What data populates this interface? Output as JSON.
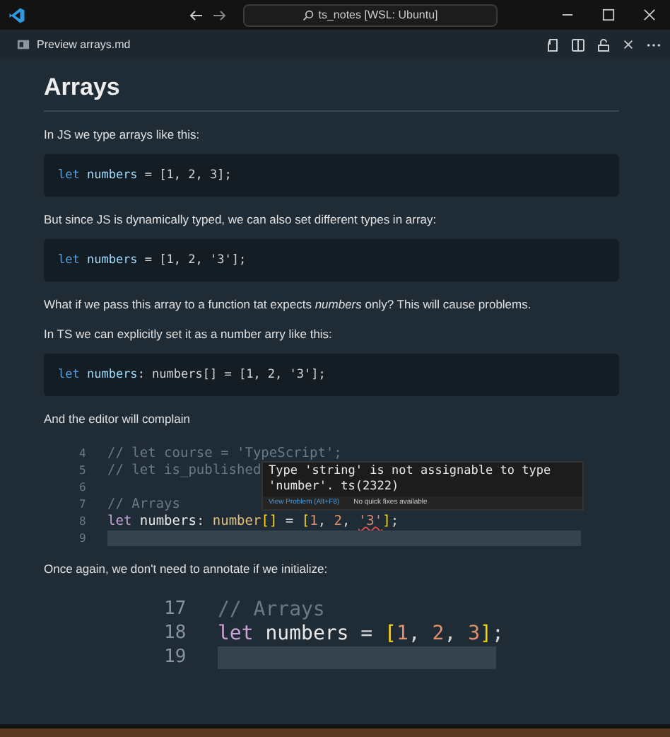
{
  "titlebar": {
    "search": "ts_notes [WSL: Ubuntu]"
  },
  "tab": {
    "title": "Preview arrays.md"
  },
  "content": [
    {
      "kind": "heading",
      "text": "Arrays"
    },
    {
      "kind": "paragraph",
      "text": "In JS we type arrays like this:"
    },
    {
      "kind": "code",
      "tokens": [
        {
          "kind": "keyword",
          "t": "let"
        },
        {
          "kind": "variable",
          "t": " numbers"
        },
        {
          "kind": "plain",
          "t": " = [1, 2, 3];"
        }
      ]
    },
    {
      "kind": "paragraph",
      "text": "But since JS is dynamically typed, we can also set different types in array:"
    },
    {
      "kind": "code",
      "tokens": [
        {
          "kind": "keyword",
          "t": "let"
        },
        {
          "kind": "variable",
          "t": " numbers"
        },
        {
          "kind": "plain",
          "t": " = [1, 2, '3'];"
        }
      ]
    },
    {
      "kind": "paragraph",
      "text": "What if we pass this array to a function tat expects *numbers* only? This will cause problems."
    },
    {
      "kind": "paragraph",
      "text": "In TS we can explicitly set it as a number arry like this:"
    },
    {
      "kind": "code",
      "tokens": [
        {
          "kind": "keyword",
          "t": "let"
        },
        {
          "kind": "variable",
          "t": " numbers"
        },
        {
          "kind": "plain",
          "t": ": numbers[] = [1, 2, '3'];"
        }
      ]
    },
    {
      "kind": "paragraph",
      "text": "And the editor will complain"
    },
    {
      "kind": "screenshot",
      "lines": [
        {
          "n": "4",
          "current": false,
          "tokens": [
            {
              "kind": "comment",
              "t": "// let course = 'TypeScript';"
            }
          ]
        },
        {
          "n": "5",
          "current": false,
          "tokens": [
            {
              "kind": "comment",
              "t": "// let is_published"
            }
          ]
        },
        {
          "n": "6",
          "current": false
        },
        {
          "n": "7",
          "current": false,
          "tokens": [
            {
              "kind": "comment",
              "t": "// Arrays"
            }
          ]
        },
        {
          "n": "8",
          "current": false,
          "tokens": [
            {
              "kind": "keyword",
              "t": "let"
            },
            {
              "kind": "variable",
              "t": " numbers"
            },
            {
              "kind": "plain",
              "t": ": "
            },
            {
              "kind": "type",
              "t": "number"
            },
            {
              "kind": "bracket",
              "t": "[]"
            },
            {
              "kind": "plain",
              "t": " = "
            },
            {
              "kind": "bracket",
              "t": "["
            },
            {
              "kind": "number",
              "t": "1"
            },
            {
              "kind": "plain",
              "t": ", "
            },
            {
              "kind": "number",
              "t": "2"
            },
            {
              "kind": "plain",
              "t": ", "
            },
            {
              "kind": "string",
              "t": "'3'",
              "error": true
            },
            {
              "kind": "bracket",
              "t": "]"
            },
            {
              "kind": "plain",
              "t": ";"
            }
          ]
        },
        {
          "n": "9",
          "current": true
        }
      ],
      "tooltip": {
        "message": "Type 'string' is not assignable to type 'number'. ts(2322)",
        "link": "View Problem (Alt+F8)",
        "note": "No quick fixes available"
      }
    },
    {
      "kind": "paragraph",
      "text": "Once again, we don't need to annotate if we initialize:"
    },
    {
      "kind": "zoomshot",
      "lines": [
        {
          "n": "17",
          "current": false,
          "tokens": [
            {
              "kind": "comment",
              "t": "// Arrays"
            }
          ]
        },
        {
          "n": "18",
          "current": false,
          "tokens": [
            {
              "kind": "keyword",
              "t": "let"
            },
            {
              "kind": "variable",
              "t": " numbers"
            },
            {
              "kind": "plain",
              "t": " = "
            },
            {
              "kind": "bracket",
              "t": "["
            },
            {
              "kind": "number",
              "t": "1"
            },
            {
              "kind": "plain",
              "t": ", "
            },
            {
              "kind": "number",
              "t": "2"
            },
            {
              "kind": "plain",
              "t": ", "
            },
            {
              "kind": "number",
              "t": "3"
            },
            {
              "kind": "bracket",
              "t": "]"
            },
            {
              "kind": "plain",
              "t": ";"
            }
          ]
        },
        {
          "n": "19",
          "current": true
        }
      ]
    }
  ]
}
